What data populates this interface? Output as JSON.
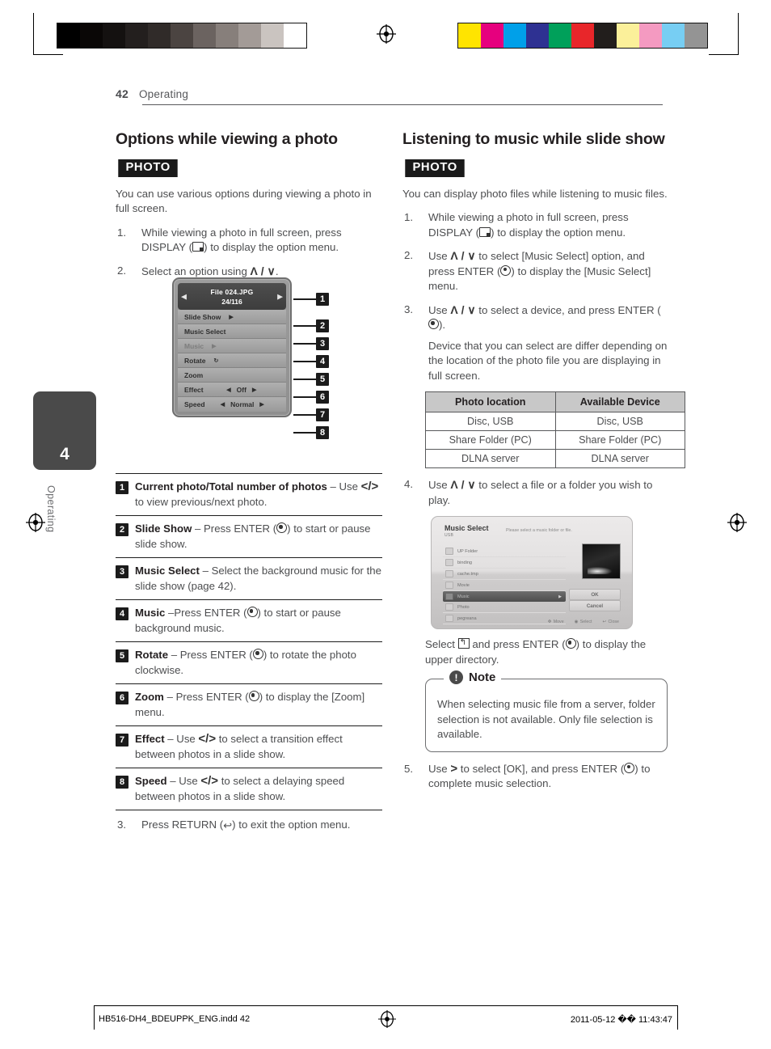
{
  "page": {
    "number": "42",
    "section": "Operating",
    "chapter_number": "4",
    "chapter_label": "Operating"
  },
  "color_bars": {
    "gray": [
      "#000000",
      "#0a0706",
      "#141110",
      "#231f1e",
      "#302b29",
      "#4b4441",
      "#6b6360",
      "#877f7b",
      "#a39b97",
      "#cac4c0",
      "#ffffff"
    ],
    "color": [
      "#ffe400",
      "#e6007e",
      "#00a0e9",
      "#2e3192",
      "#00a05a",
      "#e8262a",
      "#221e1c",
      "#fbf09a",
      "#f49ac1",
      "#77cef3",
      "#949494"
    ]
  },
  "left_column": {
    "heading": "Options while viewing a photo",
    "badge": "PHOTO",
    "intro": "You can use various options during viewing a photo in full screen.",
    "steps": [
      {
        "n": "1.",
        "text_before": "While viewing a photo in full screen, press DISPLAY (",
        "icon": "display-icon",
        "text_after": ") to display the option menu."
      },
      {
        "n": "2.",
        "text_before": "Select an option using ",
        "arrows": "Λ / ∨",
        "text_after": "."
      }
    ],
    "final_step": {
      "n": "3.",
      "text_before": "Press RETURN (",
      "icon": "return-icon",
      "text_after": ") to exit the option menu."
    },
    "osd": {
      "file_name": "File 024.JPG",
      "counter": "24/116",
      "left_arrow": "◀",
      "right_arrow": "▶",
      "rows": [
        {
          "label": "Slide Show",
          "marker": "▶",
          "dim": false,
          "type": "play"
        },
        {
          "label": "Music Select",
          "marker": "",
          "dim": false,
          "type": "plain"
        },
        {
          "label": "Music",
          "marker": "▶",
          "dim": true,
          "type": "play"
        },
        {
          "label": "Rotate",
          "marker": "↻",
          "dim": false,
          "type": "play"
        },
        {
          "label": "Zoom",
          "marker": "",
          "dim": false,
          "type": "plain"
        },
        {
          "label": "Effect",
          "value": "Off",
          "left": "◀",
          "right": "▶",
          "dim": false,
          "type": "spinner"
        },
        {
          "label": "Speed",
          "value": "Normal",
          "left": "◀",
          "right": "▶",
          "dim": false,
          "type": "spinner"
        }
      ]
    },
    "callouts": [
      "1",
      "2",
      "3",
      "4",
      "5",
      "6",
      "7",
      "8"
    ],
    "legend": [
      {
        "n": "1",
        "title": "Current photo/Total number of photos",
        "rest_pre": " – Use ",
        "arrows": "</>",
        "rest_post": " to view previous/next photo."
      },
      {
        "n": "2",
        "title": "Slide Show",
        "rest_pre": " – Press ENTER (",
        "icon": "enter-icon",
        "rest_post": ") to start or pause slide show."
      },
      {
        "n": "3",
        "title": "Music Select",
        "rest_pre": " – Select the background music for the slide show (page 42).",
        "icon": "",
        "rest_post": ""
      },
      {
        "n": "4",
        "title": "Music",
        "rest_pre": " –Press ENTER (",
        "icon": "enter-icon",
        "rest_post": ") to start or pause background music."
      },
      {
        "n": "5",
        "title": "Rotate",
        "rest_pre": " – Press ENTER (",
        "icon": "enter-icon",
        "rest_post": ") to rotate the photo clockwise."
      },
      {
        "n": "6",
        "title": "Zoom",
        "rest_pre": " – Press ENTER (",
        "icon": "enter-icon",
        "rest_post": ") to display the [Zoom] menu."
      },
      {
        "n": "7",
        "title": "Effect",
        "rest_pre": " – Use ",
        "arrows": "</>",
        "rest_post": " to select a transition effect between photos in a slide show."
      },
      {
        "n": "8",
        "title": "Speed",
        "rest_pre": " – Use ",
        "arrows": "</>",
        "rest_post": " to select a delaying speed between photos in a slide show."
      }
    ]
  },
  "right_column": {
    "heading": "Listening to music while slide show",
    "badge": "PHOTO",
    "intro": "You can display photo files while listening to music files.",
    "step1": {
      "n": "1.",
      "pre": "While viewing a photo in full screen, press DISPLAY (",
      "post": ") to display the option menu."
    },
    "step2": {
      "n": "2.",
      "pre": "Use ",
      "arrows": "Λ / ∨",
      "mid": " to select [Music Select] option, and press ENTER (",
      "post": ") to display the [Music Select] menu."
    },
    "step3": {
      "n": "3.",
      "pre": "Use ",
      "arrows": "Λ / ∨",
      "mid": " to select a device, and press ENTER (",
      "post": ").",
      "note": "Device that you can select are differ depending on the location of the photo file you are displaying in full screen."
    },
    "table": {
      "headers": [
        "Photo location",
        "Available Device"
      ],
      "rows": [
        [
          "Disc, USB",
          "Disc, USB"
        ],
        [
          "Share Folder (PC)",
          "Share Folder (PC)"
        ],
        [
          "DLNA server",
          "DLNA server"
        ]
      ]
    },
    "step4": {
      "n": "4.",
      "pre": "Use ",
      "arrows": "Λ / ∨",
      "post": " to select a file or a folder you wish to play."
    },
    "music_select": {
      "title": "Music Select",
      "subtitle": "USB",
      "hint": "Please select a music folder or file.",
      "items": [
        {
          "label": "UP Folder",
          "selected": false,
          "up": true
        },
        {
          "label": "binding",
          "selected": false
        },
        {
          "label": "cache.tmp",
          "selected": false
        },
        {
          "label": "Movie",
          "selected": false
        },
        {
          "label": "Music",
          "selected": true
        },
        {
          "label": "Photo",
          "selected": false
        },
        {
          "label": "pegreana",
          "selected": false
        }
      ],
      "ok_label": "OK",
      "cancel_label": "Cancel",
      "footer": [
        "Move",
        "Select",
        "Close"
      ]
    },
    "caption": {
      "pre": "Select ",
      "post": " and press ENTER (",
      "tail": ") to display the upper directory."
    },
    "note": {
      "title": "Note",
      "body": "When selecting music file from a server, folder selection is not available. Only file selection is available."
    },
    "step5": {
      "n": "5.",
      "pre": "Use ",
      "arrow": ">",
      "mid": " to select [OK], and press ENTER (",
      "post": ") to complete music selection."
    }
  },
  "footer": {
    "left": "HB516-DH4_BDEUPPK_ENG.indd   42",
    "right": "2011-05-12   �� 11:43:47"
  }
}
